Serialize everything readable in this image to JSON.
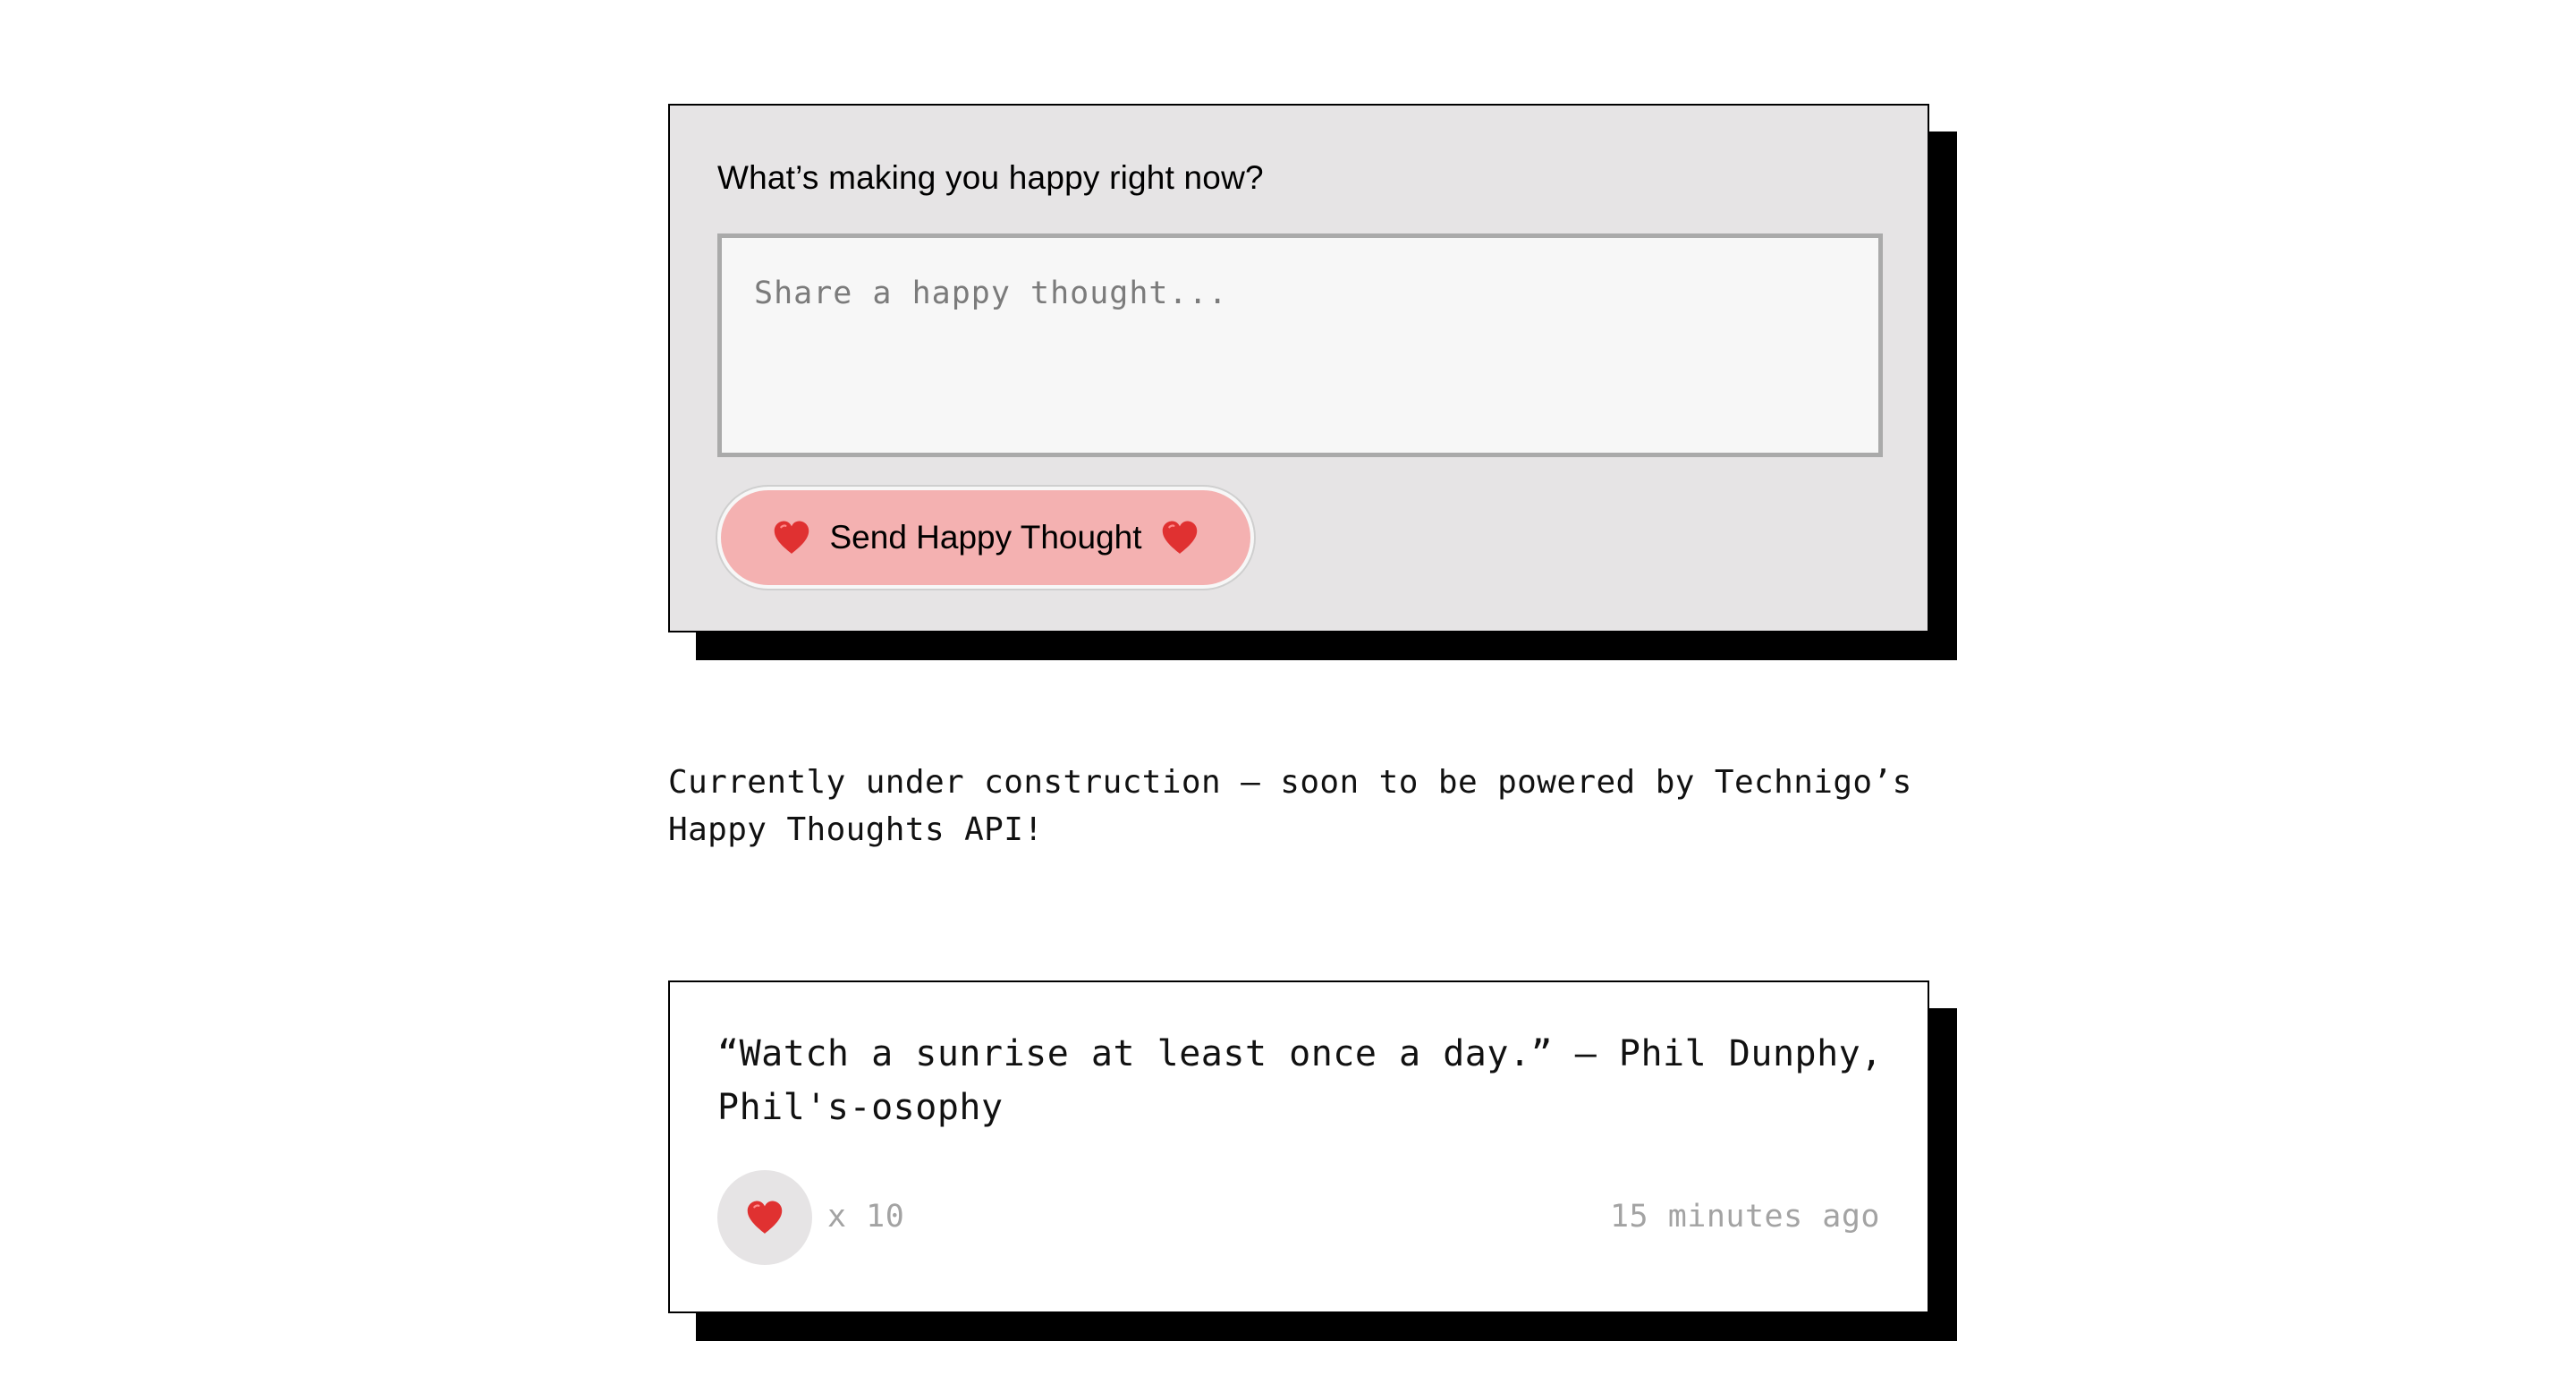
{
  "form": {
    "label": "What’s making you happy right now?",
    "input_value": "",
    "input_placeholder": "Share a happy thought...",
    "button_label": "Send Happy Thought",
    "button_icon": "heart-icon",
    "button_color": "#f4b1b1",
    "card_background": "#e6e4e5"
  },
  "notice": {
    "text": "Currently under construction — soon to be powered by Technigo’s Happy Thoughts API!"
  },
  "thoughts": [
    {
      "message": "“Watch a sunrise at least once a day.” — Phil Dunphy, Phil's-osophy",
      "like_icon": "heart-icon",
      "likes_text": "x 10",
      "time_text": "15 minutes ago"
    }
  ],
  "colors": {
    "heart": "#e03131",
    "shadow": "#000000",
    "muted_text": "#a3a3a3"
  }
}
